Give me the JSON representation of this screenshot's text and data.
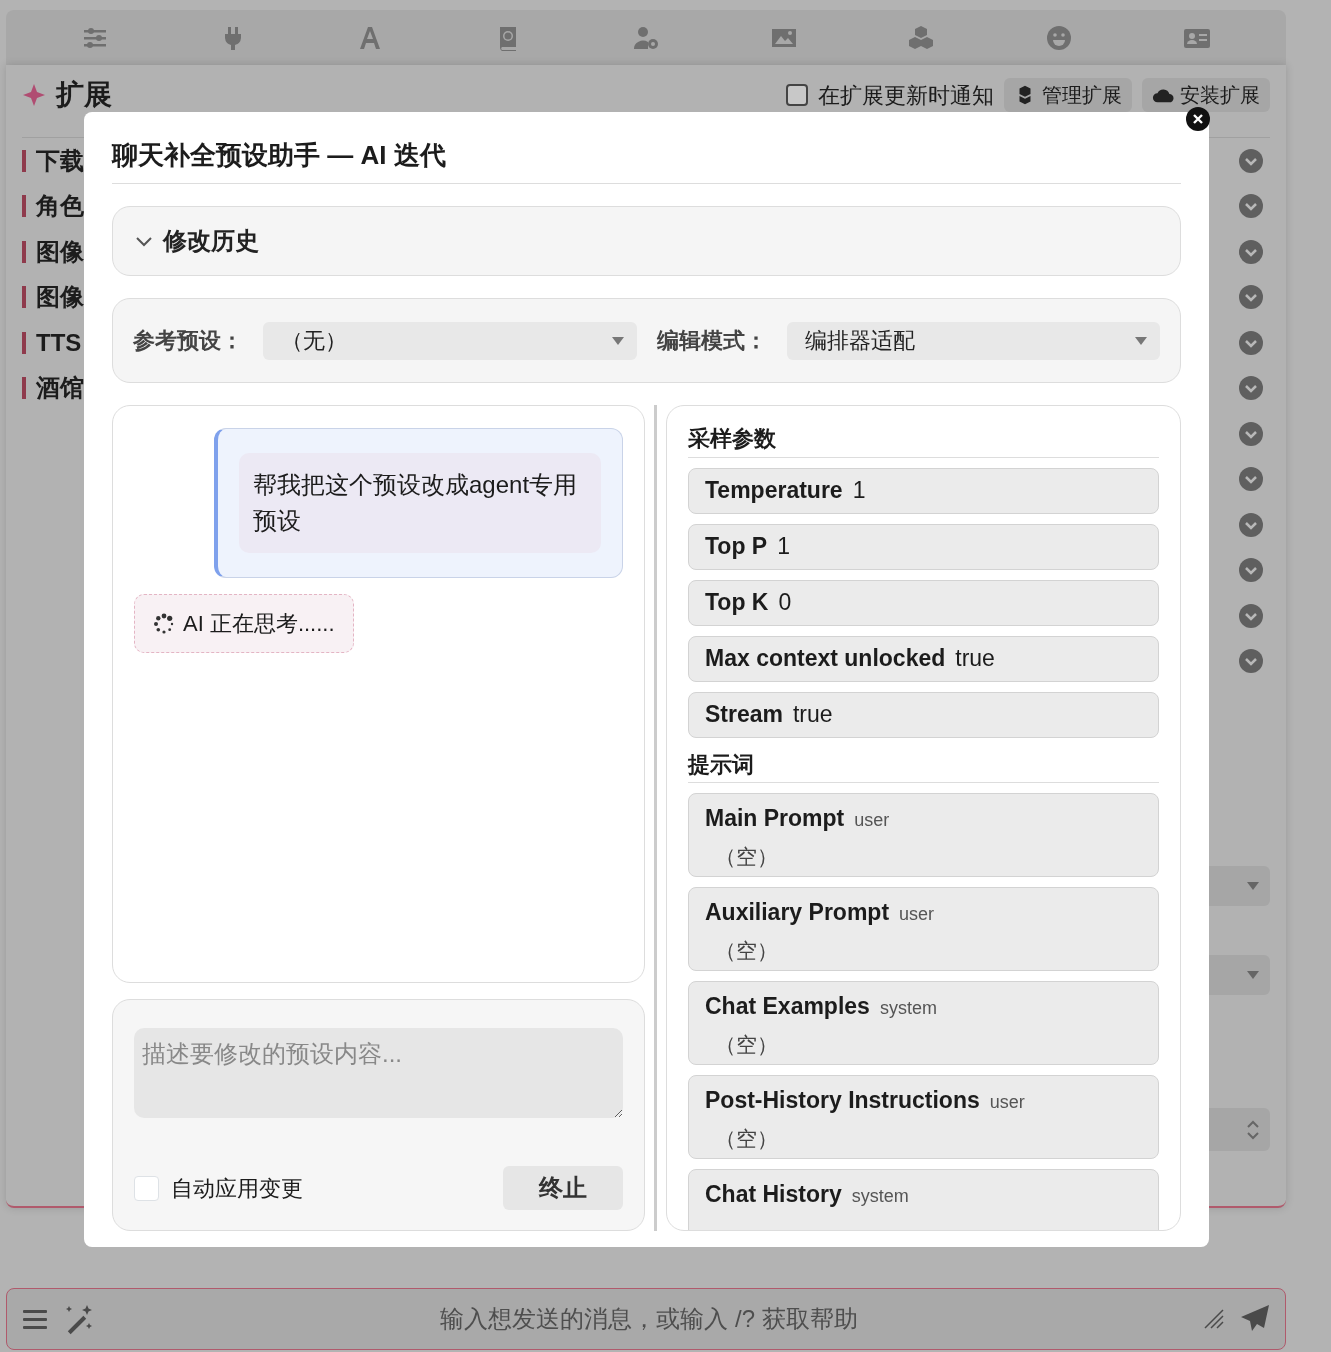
{
  "extensions_panel": {
    "title": "扩展",
    "notify_checkbox": {
      "label": "在扩展更新时通知",
      "checked": false
    },
    "buttons": [
      "管理扩展",
      "安装扩展"
    ],
    "items": [
      {
        "label": "下载"
      },
      {
        "label": "角色"
      },
      {
        "label": "图像"
      },
      {
        "label": "图像"
      },
      {
        "label": "TTS"
      },
      {
        "label": "酒馆"
      }
    ]
  },
  "chat_bar": {
    "placeholder": "输入想发送的消息，或输入 /? 获取帮助"
  },
  "dialog": {
    "title": "聊天补全预设助手 — AI 迭代",
    "history": {
      "label": "修改历史",
      "expanded": false
    },
    "reference_preset": {
      "label": "参考预设：",
      "value": "（无）"
    },
    "edit_mode": {
      "label": "编辑模式：",
      "value": "编排器适配"
    },
    "messages": [
      {
        "kind": "user",
        "text": "帮我把这个预设改成agent专用预设"
      },
      {
        "kind": "status",
        "text": "AI 正在思考......"
      }
    ],
    "composer": {
      "placeholder": "描述要修改的预设内容...",
      "auto_apply": {
        "label": "自动应用变更",
        "checked": false
      },
      "stop_button": "终止"
    },
    "sections": [
      {
        "kind": "params",
        "title": "采样参数",
        "items": [
          {
            "name": "Temperature",
            "value": "1"
          },
          {
            "name": "Top P",
            "value": "1"
          },
          {
            "name": "Top K",
            "value": "0"
          },
          {
            "name": "Max context unlocked",
            "value": "true"
          },
          {
            "name": "Stream",
            "value": "true"
          }
        ]
      },
      {
        "kind": "prompts",
        "title": "提示词",
        "items": [
          {
            "name": "Main Prompt",
            "role": "user",
            "content": "（空）"
          },
          {
            "name": "Auxiliary Prompt",
            "role": "user",
            "content": "（空）"
          },
          {
            "name": "Chat Examples",
            "role": "system",
            "content": "（空）"
          },
          {
            "name": "Post-History Instructions",
            "role": "user",
            "content": "（空）"
          },
          {
            "name": "Chat History",
            "role": "system"
          }
        ]
      }
    ]
  }
}
